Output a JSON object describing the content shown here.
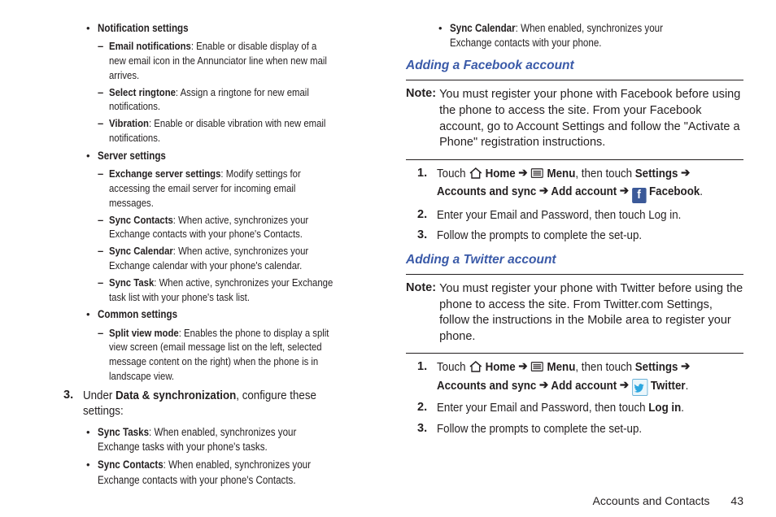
{
  "left": {
    "notificationHeading": "Notification settings",
    "emailNotifLabel": "Email notifications",
    "emailNotifDesc": ": Enable or disable display of a new email icon in the Annunciator line when new mail arrives.",
    "selectRingtoneLabel": "Select ringtone",
    "selectRingtoneDesc": ": Assign a ringtone for new email notifications.",
    "vibrationLabel": "Vibration",
    "vibrationDesc": ": Enable or disable vibration with new email notifications.",
    "serverHeading": "Server settings",
    "exchangeLabel": "Exchange server settings",
    "exchangeDesc": ": Modify settings for accessing the email server for incoming email messages.",
    "syncContactsLabel": "Sync Contacts",
    "syncContactsDesc": ": When active, synchronizes your Exchange contacts with your phone's Contacts.",
    "syncCalendarLabel": "Sync Calendar",
    "syncCalendarDesc": ": When active, synchronizes your Exchange calendar with your phone's calendar.",
    "syncTaskLabel": "Sync Task",
    "syncTaskDesc": ": When active, synchronizes your Exchange task list with your phone's task list.",
    "commonHeading": "Common settings",
    "splitViewLabel": "Split view mode",
    "splitViewDesc": ": Enables the phone to display a split view screen (email message list on the left, selected message content on the right) when the phone is in landscape view.",
    "step3num": "3.",
    "step3_pre": "Under ",
    "step3_bold": "Data & synchronization",
    "step3_post": ", configure these settings:",
    "syncTasks2Label": "Sync Tasks",
    "syncTasks2Desc": ": When enabled, synchronizes your Exchange tasks with your phone's tasks.",
    "syncContacts2Label": "Sync Contacts",
    "syncContacts2Desc": ": When enabled, synchronizes your Exchange contacts with your phone's Contacts."
  },
  "right": {
    "syncCalendar2Label": "Sync Calendar",
    "syncCalendar2Desc": ": When enabled, synchronizes your Exchange contacts with your phone.",
    "fbHeading": "Adding a Facebook account",
    "fbNoteLabel": "Note:",
    "fbNoteText": "You must register your phone with Facebook before using the phone to access the site. From your Facebook account, go to Account Settings and follow the \"Activate a Phone\" registration instructions.",
    "s1num": "1.",
    "touch": "Touch ",
    "home": "Home",
    "menu": "Menu",
    "thenTouch": ", then touch ",
    "settings": "Settings",
    "accountsSync": "Accounts and sync",
    "addAccount": "Add account",
    "facebook": "Facebook",
    "period": ".",
    "s2num": "2.",
    "s2text": "Enter your Email and Password, then touch Log in.",
    "s3num": "3.",
    "s3text": "Follow the prompts to complete the set-up.",
    "twHeading": "Adding a Twitter account",
    "twNoteLabel": "Note:",
    "twNoteText": "You must register your phone with Twitter before using the phone to access the site. From Twitter.com Settings, follow the instructions in the Mobile area to register your phone.",
    "twitter": "Twitter",
    "t2text_pre": "Enter your Email and Password, then touch ",
    "login": "Log in",
    "t3text": "Follow the prompts to complete the set-up."
  },
  "footer": {
    "section": "Accounts and Contacts",
    "page": "43"
  },
  "arrow": "➔"
}
